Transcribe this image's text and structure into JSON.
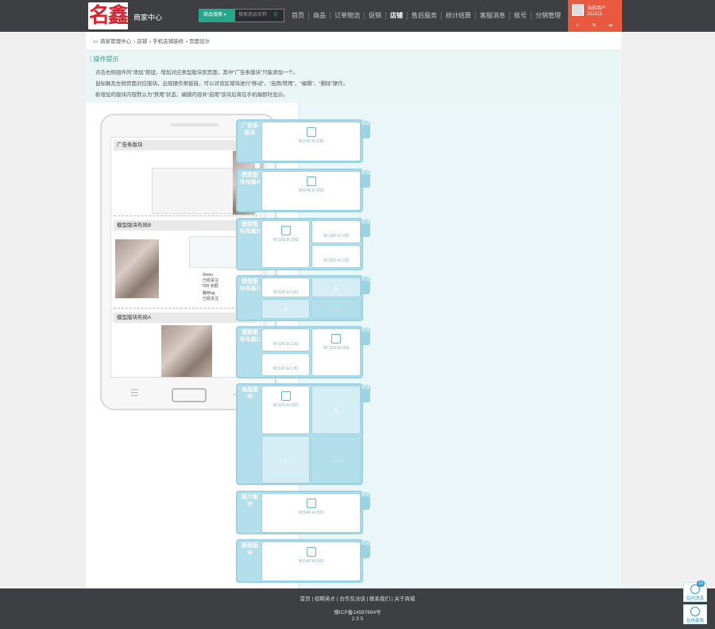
{
  "header": {
    "logo": "名鑫",
    "brand": "商家中心",
    "search_select": "商品搜索",
    "search_placeholder": "搜索商品名称",
    "nav": [
      "首页",
      "商品",
      "订单物流",
      "促销",
      "店铺",
      "售后服务",
      "统计结算",
      "客服消息",
      "账号",
      "分销管理"
    ],
    "active_nav": "店铺",
    "user": {
      "label": "当前用户",
      "name": "111111"
    }
  },
  "breadcrumb": [
    "商家管理中心",
    "店铺",
    "手机店铺装修",
    "页面设计"
  ],
  "tips": {
    "title": "操作提示",
    "lines": [
      "点击右侧组件的“添加”按钮，增加对应类型版块到页面，其中“广告条版块”只能添加一个。",
      "鼠标触及左侧页面对应版块，出现操作类链接，可以对该区域块进行“移动”、“启用/禁用”、“编辑”、“删除”操作。",
      "新增加的版块内容默认为“禁用”状态，编辑内容并“启用”该块后将在手机端即时显示。"
    ]
  },
  "preview": {
    "blocks": [
      "广告条版块",
      "模型版块布局B",
      "模型版块布局A"
    ],
    "shop1": {
      "name": "Sheer",
      "sub": "已经关注",
      "count": "555 余额"
    },
    "shop2": {
      "name": "静存qq",
      "sub": "已经关注",
      "count": "555 余额"
    }
  },
  "modules": [
    {
      "label": "广告条版块",
      "add": "添加",
      "cells": [
        "W:640 H:240"
      ]
    },
    {
      "label": "模型版块布局A",
      "add": "添加",
      "cells": [
        "W:640 H:200"
      ]
    },
    {
      "label": "模型版块布局B",
      "add": "添加",
      "cells": [
        "W:320 H:260",
        "W:320 H:130",
        "W:320 H:130"
      ]
    },
    {
      "label": "模型版块布局C",
      "add": "添加",
      "cells": [
        "W:320 H:130",
        "+",
        "+",
        "···"
      ]
    },
    {
      "label": "模型版块布局D",
      "add": "添加",
      "cells": [
        "W:320 H:130",
        "W:320 H:130",
        "W:320 H:260"
      ]
    },
    {
      "label": "商品版块",
      "add": "添加",
      "cells": [
        "W:320 H:320",
        "+",
        "+",
        "···"
      ]
    },
    {
      "label": "简介版块",
      "add": "添加",
      "cells": [
        "W:640 H:300"
      ]
    },
    {
      "label": "新闻版块",
      "add": "添加",
      "cells": [
        "W:640 H:300"
      ]
    }
  ],
  "footer": {
    "links": "首页 | 招聘英才 | 合作及洽谈 | 联系我们 | 关于商城",
    "icp": "豫ICP备14587664号",
    "version": "2 3 5"
  },
  "side": {
    "msg": "站内消息",
    "msg_count": "18",
    "service": "在线客服"
  }
}
